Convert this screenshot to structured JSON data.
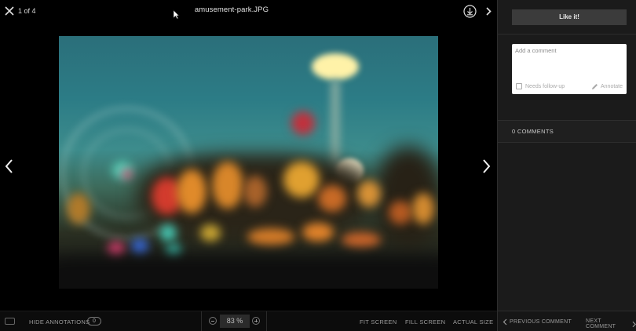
{
  "viewer": {
    "counter": "1 of 4",
    "filename": "amusement-park.JPG",
    "icons": {
      "close": "close-icon",
      "download": "download-icon",
      "next_top": "chevron-right-icon",
      "prev": "chevron-left-icon",
      "next": "chevron-right-icon"
    }
  },
  "toolbar": {
    "keyboard_icon": "keyboard-icon",
    "hide_annotations": "HIDE ANNOTATIONS",
    "annotation_count": "0",
    "zoom_value": "83 %",
    "fit_screen": "FIT SCREEN",
    "fill_screen": "FILL SCREEN",
    "actual_size": "ACTUAL SIZE"
  },
  "sidebar": {
    "like_label": "Like it!",
    "comment_placeholder": "Add a comment",
    "needs_followup": "Needs follow-up",
    "annotate": "Annotate",
    "comments_count": "0 COMMENTS",
    "previous_comment": "PREVIOUS COMMENT",
    "next_comment": "NEXT COMMENT"
  },
  "colors": {
    "background": "#000000",
    "sidebar": "#1b1b1b",
    "button": "#3b3b3b"
  }
}
